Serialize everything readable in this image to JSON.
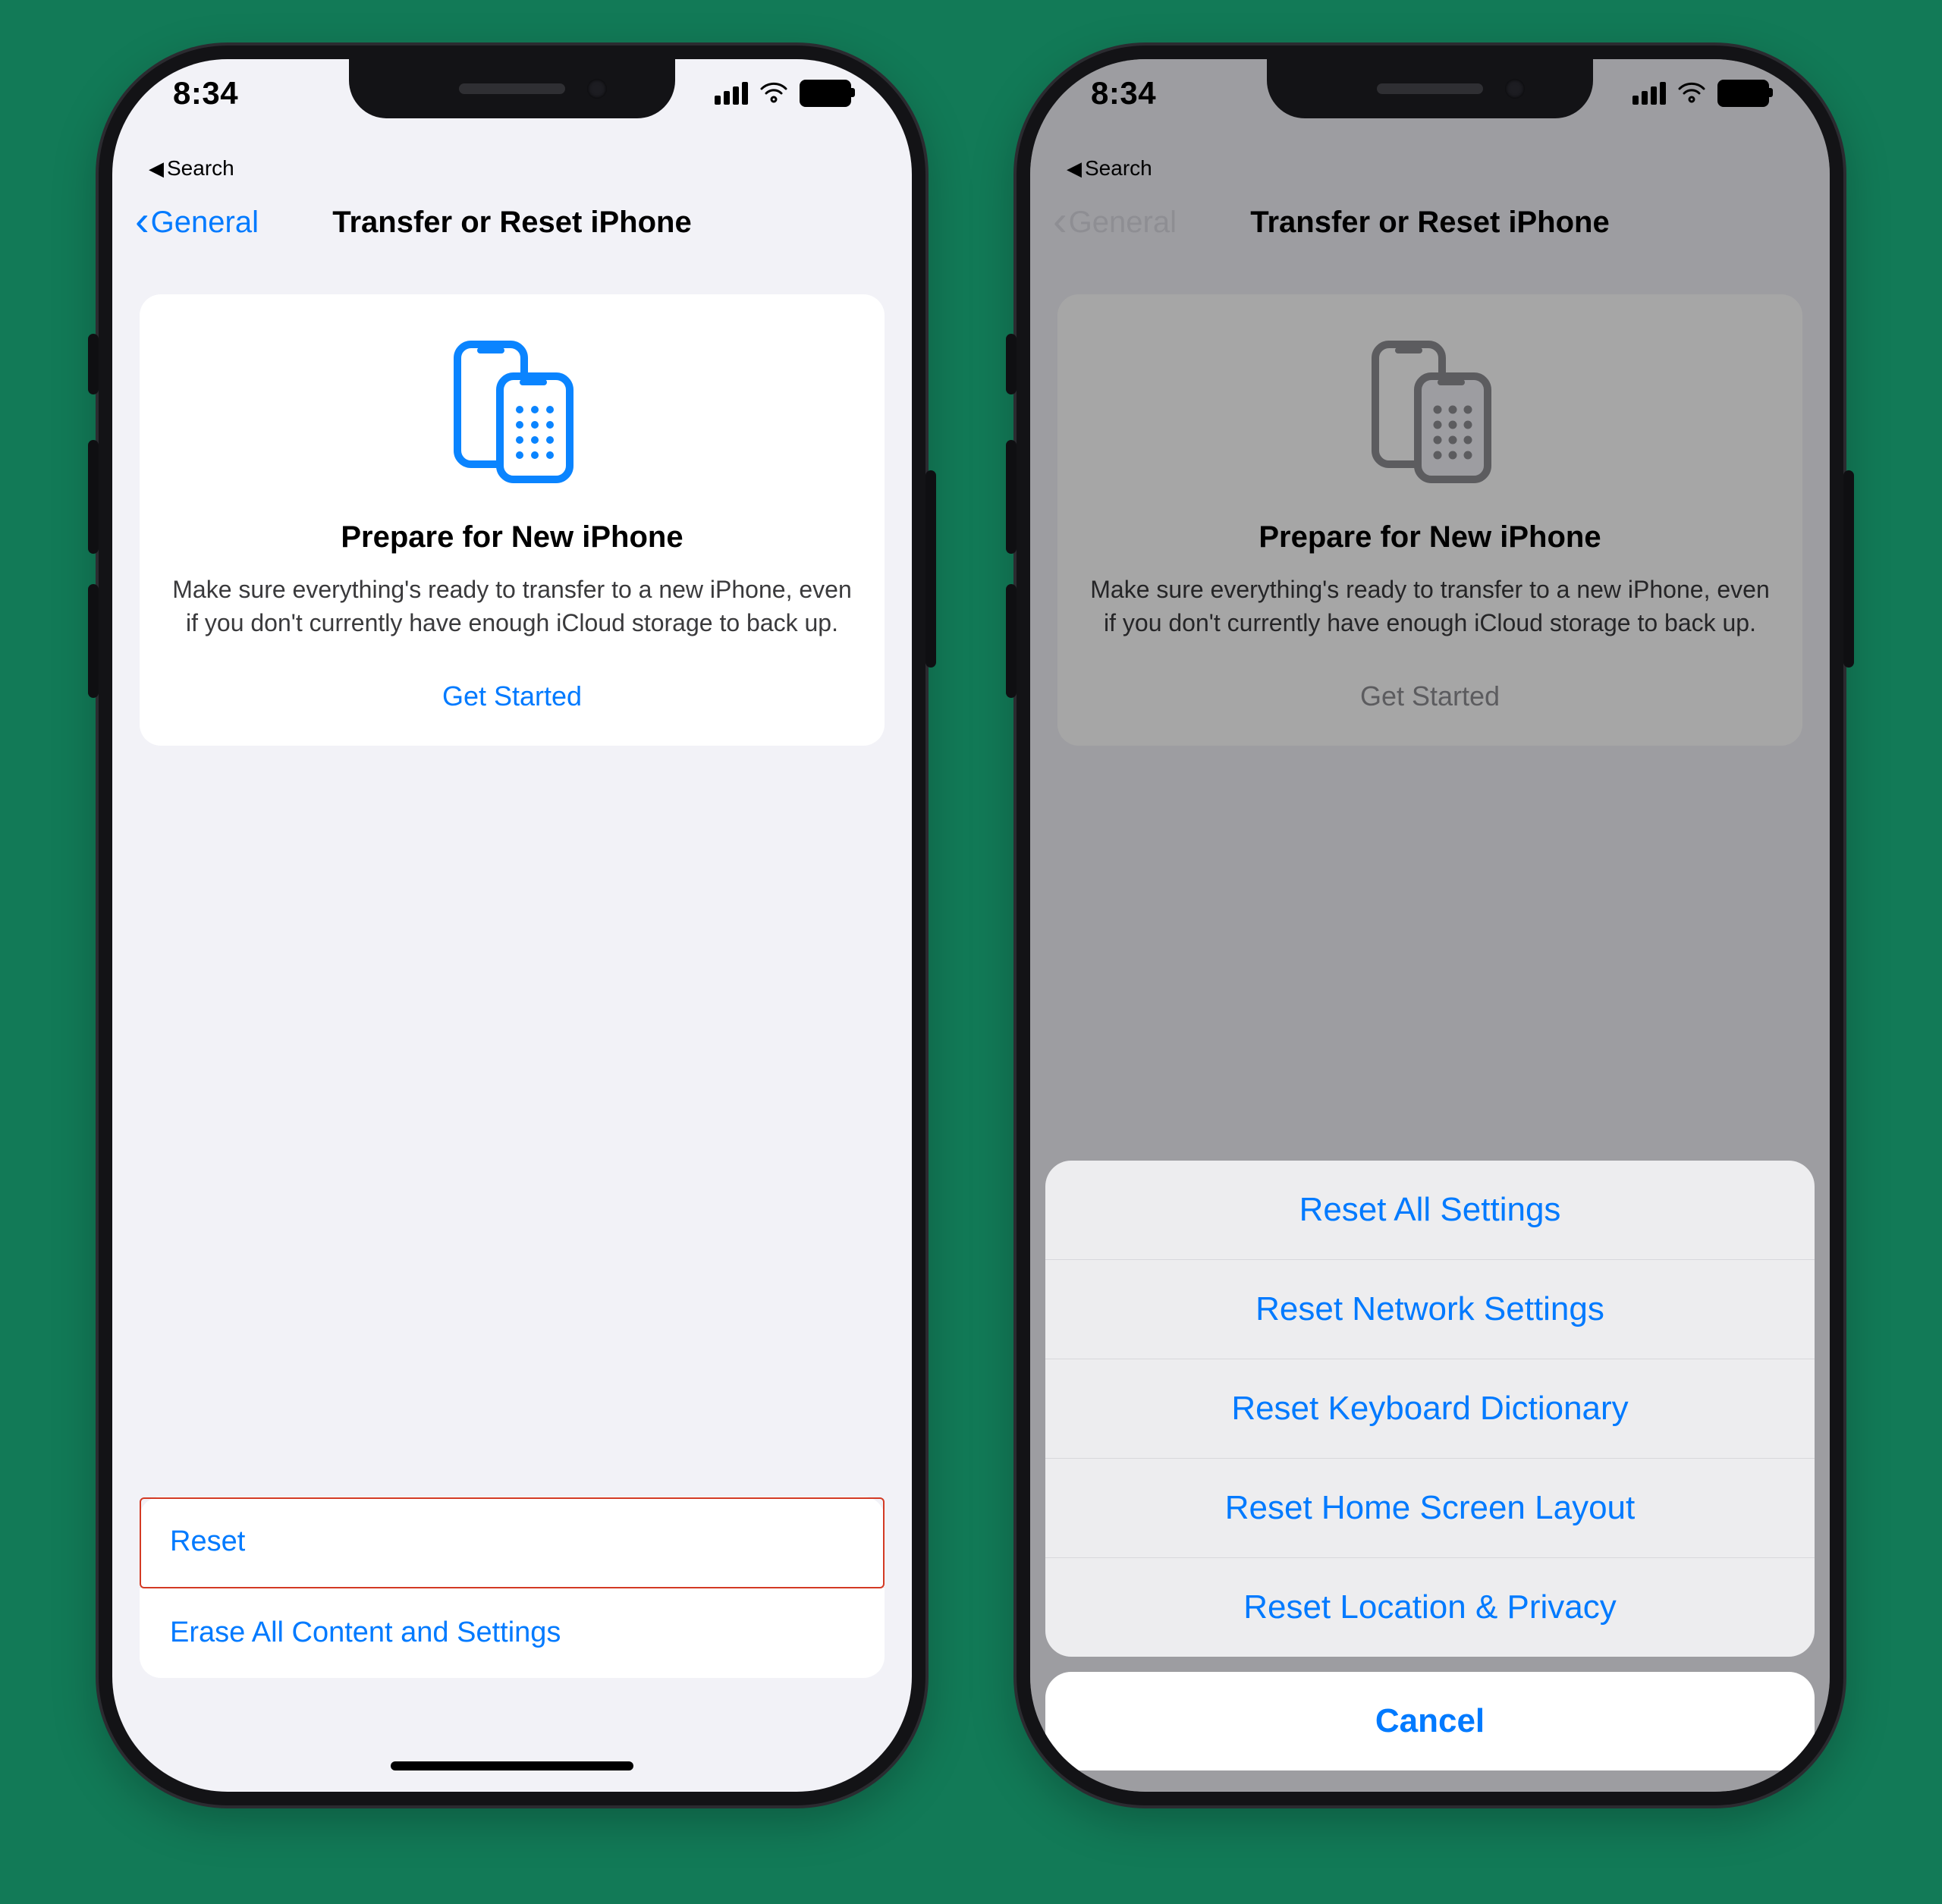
{
  "status": {
    "time": "8:34"
  },
  "breadcrumb": {
    "label": "Search"
  },
  "nav": {
    "back": "General",
    "title": "Transfer or Reset iPhone"
  },
  "card": {
    "title": "Prepare for New iPhone",
    "body": "Make sure everything's ready to transfer to a new iPhone, even if you don't currently have enough iCloud storage to back up.",
    "cta": "Get Started"
  },
  "bottom": {
    "reset": "Reset",
    "erase": "Erase All Content and Settings"
  },
  "sheet": {
    "items": [
      "Reset All Settings",
      "Reset Network Settings",
      "Reset Keyboard Dictionary",
      "Reset Home Screen Layout",
      "Reset Location & Privacy"
    ],
    "cancel": "Cancel"
  }
}
